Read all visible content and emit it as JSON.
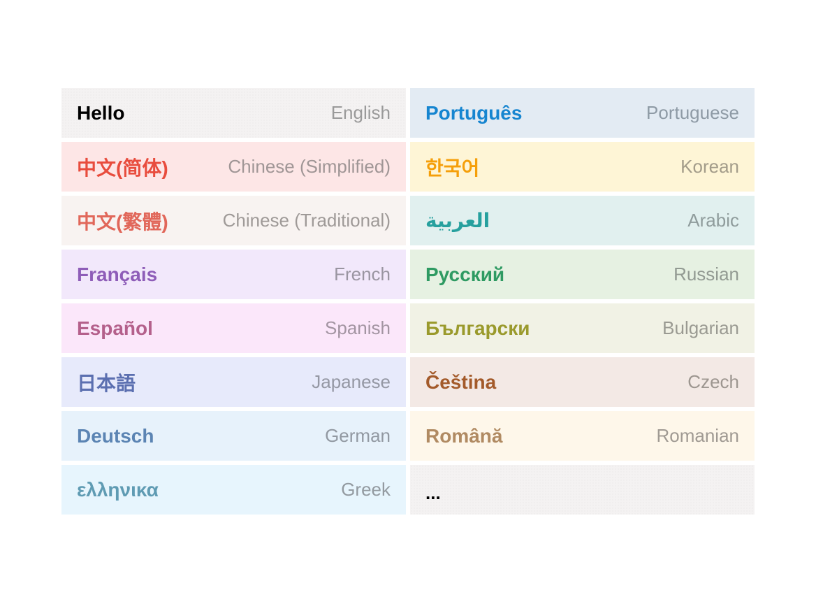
{
  "languages": [
    {
      "native": "Hello",
      "english": "English",
      "text_color": "#000000",
      "label_color": "#9a9a9a",
      "bg": "#f4f2f2"
    },
    {
      "native": "Português",
      "english": "Portuguese",
      "text_color": "#1685d0",
      "label_color": "#8e9aa5",
      "bg": "#e3ebf3"
    },
    {
      "native": "中文(简体)",
      "english": "Chinese (Simplified)",
      "text_color": "#e84c3d",
      "label_color": "#a09696",
      "bg": "#fde6e6"
    },
    {
      "native": "한국어",
      "english": "Korean",
      "text_color": "#f59f0a",
      "label_color": "#a39c8a",
      "bg": "#fef5d6"
    },
    {
      "native": "中文(繁體)",
      "english": "Chinese (Traditional)",
      "text_color": "#e1675a",
      "label_color": "#9f9a98",
      "bg": "#f8f3f1"
    },
    {
      "native": "العربية",
      "english": "Arabic",
      "text_color": "#26a09e",
      "label_color": "#8f9c9c",
      "bg": "#e1f0ef"
    },
    {
      "native": "Français",
      "english": "French",
      "text_color": "#8e5db8",
      "label_color": "#9a95a1",
      "bg": "#f2e8fb"
    },
    {
      "native": "Русский",
      "english": "Russian",
      "text_color": "#2e9a62",
      "label_color": "#929a92",
      "bg": "#e6f1e2"
    },
    {
      "native": "Español",
      "english": "Spanish",
      "text_color": "#b4608b",
      "label_color": "#a395a2",
      "bg": "#fbe7fa"
    },
    {
      "native": "Български",
      "english": "Bulgarian",
      "text_color": "#9a9a2c",
      "label_color": "#9a9a92",
      "bg": "#f1f2e5"
    },
    {
      "native": "日本語",
      "english": "Japanese",
      "text_color": "#5b6fb0",
      "label_color": "#9598a4",
      "bg": "#e7eafb"
    },
    {
      "native": "Čeština",
      "english": "Czech",
      "text_color": "#a35a2a",
      "label_color": "#9d9690",
      "bg": "#f3e9e5"
    },
    {
      "native": "Deutsch",
      "english": "German",
      "text_color": "#5b84b3",
      "label_color": "#9299a2",
      "bg": "#e7f2fb"
    },
    {
      "native": "Română",
      "english": "Romanian",
      "text_color": "#b08a62",
      "label_color": "#a09a93",
      "bg": "#fef7ea"
    },
    {
      "native": "ελληνικα",
      "english": "Greek",
      "text_color": "#5f9bb3",
      "label_color": "#939aa0",
      "bg": "#e7f5fd"
    }
  ],
  "more": {
    "label": "...",
    "bg": "#f4f2f2"
  }
}
